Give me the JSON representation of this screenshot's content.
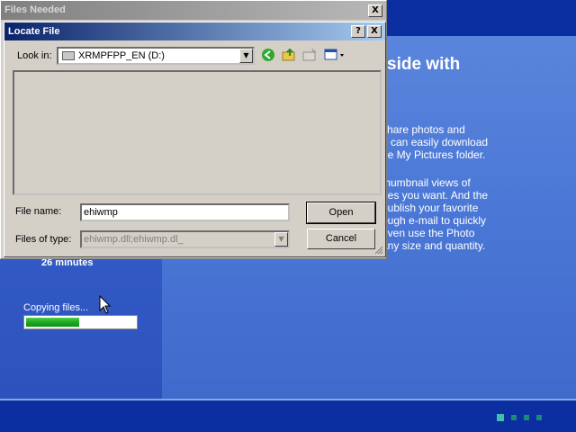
{
  "background": {
    "heading": "side with",
    "paragraph1": [
      "share photos and",
      "u can easily download",
      "he My Pictures folder."
    ],
    "paragraph2": [
      "thumbnail views of",
      "nes you want. And the",
      "publish your favorite",
      "ough e-mail to quickly",
      "even use the Photo",
      "any size and quantity."
    ],
    "time_remaining": "26 minutes",
    "status_label": "Copying files...",
    "progress_fraction": 0.49
  },
  "files_needed": {
    "title": "Files Needed",
    "close_label": "X"
  },
  "locate_file": {
    "title": "Locate File",
    "help_label": "?",
    "close_label": "X",
    "look_in_label": "Look in:",
    "look_in_value": "XRMPFPP_EN (D:)",
    "file_name_label": "File name:",
    "file_name_value": "ehiwmp",
    "files_of_type_label": "Files of type:",
    "files_of_type_value": "ehiwmp.dll;ehiwmp.dl_",
    "open_button": "Open",
    "cancel_button": "Cancel"
  },
  "colors": {
    "title_active": "#0a246a",
    "progress": "#1ea81e"
  }
}
